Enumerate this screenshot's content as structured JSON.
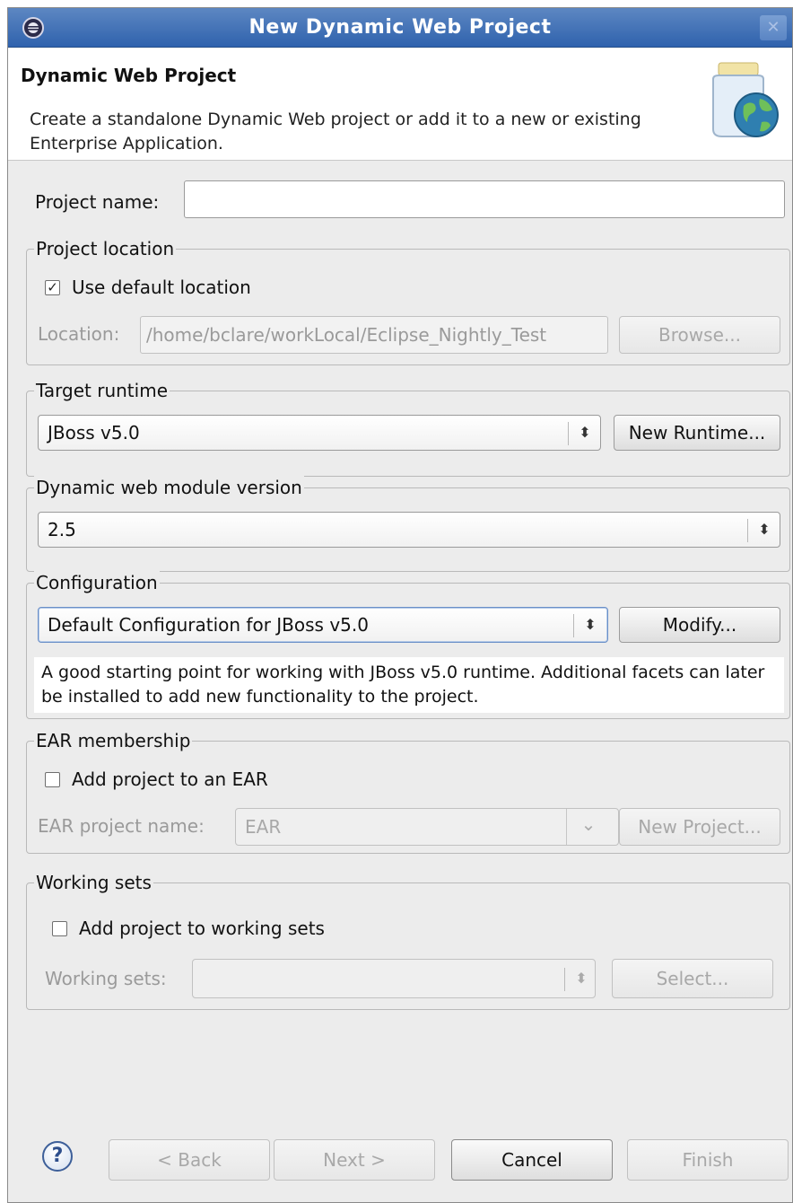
{
  "window": {
    "title": "New Dynamic Web Project",
    "close_glyph": "✕"
  },
  "header": {
    "title": "Dynamic Web Project",
    "description": "Create a standalone Dynamic Web project or add it to a new or existing Enterprise Application."
  },
  "project_name": {
    "label": "Project name:",
    "value": ""
  },
  "project_location": {
    "group_label": "Project location",
    "use_default_label": "Use default location",
    "use_default_checked": true,
    "location_label": "Location:",
    "location_value": "/home/bclare/workLocal/Eclipse_Nightly_Test",
    "browse_label": "Browse..."
  },
  "target_runtime": {
    "group_label": "Target runtime",
    "selected": "JBoss v5.0",
    "new_runtime_label": "New Runtime..."
  },
  "module_version": {
    "group_label": "Dynamic web module version",
    "selected": "2.5"
  },
  "configuration": {
    "group_label": "Configuration",
    "selected": "Default Configuration for JBoss v5.0",
    "modify_label": "Modify...",
    "description": "A good starting point for working with JBoss v5.0 runtime. Additional facets can later be installed to add new functionality to the project."
  },
  "ear_membership": {
    "group_label": "EAR membership",
    "add_label": "Add project to an EAR",
    "add_checked": false,
    "name_label": "EAR project name:",
    "name_value": "EAR",
    "new_project_label": "New Project..."
  },
  "working_sets": {
    "group_label": "Working sets",
    "add_label": "Add project to working sets",
    "add_checked": false,
    "sets_label": "Working sets:",
    "sets_value": "",
    "select_label": "Select..."
  },
  "footer": {
    "help_glyph": "?",
    "back_label": "< Back",
    "next_label": "Next >",
    "cancel_label": "Cancel",
    "finish_label": "Finish"
  },
  "icons": {
    "updown": "⬍",
    "dropdown": "⌄",
    "check": "✓"
  }
}
